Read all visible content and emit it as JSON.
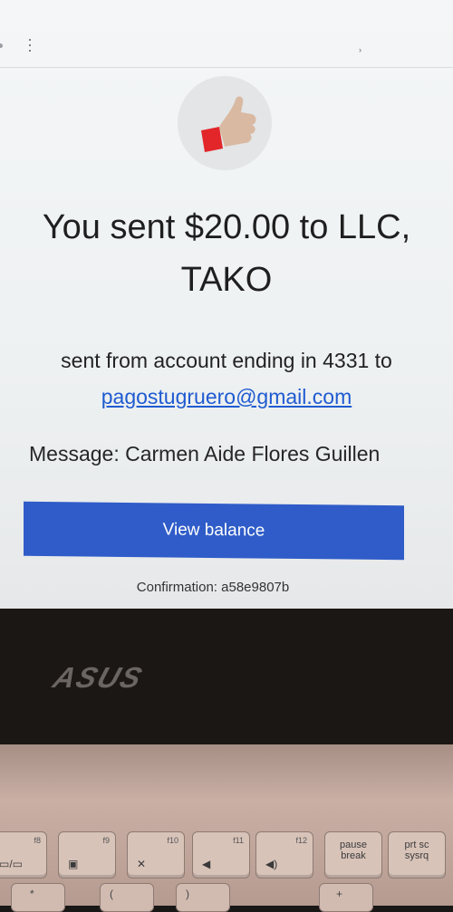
{
  "email_view": {
    "title_line1": "You sent $20.00 to LLC,",
    "title_line2": "TAKO",
    "sent_text": "sent from account ending in 4331 to",
    "email": "pagostugruero@gmail.com",
    "message": "Message: Carmen Aide Flores Guillen",
    "button_label": "View balance",
    "confirmation": "Confirmation: a58e9807b"
  },
  "brand": {
    "laptop_logo": "ASUS",
    "button_color": "#2f5cc8",
    "link_color": "#1f5bd1"
  },
  "keyboard": {
    "keys": [
      {
        "fn": "f8"
      },
      {
        "fn": "f9"
      },
      {
        "fn": "f10"
      },
      {
        "fn": "f11"
      },
      {
        "fn": "f12"
      },
      {
        "label": "pause\nbreak"
      },
      {
        "label": "prt sc\nsysrq"
      }
    ],
    "bottom_symbols": [
      "*",
      "(",
      ")",
      "+"
    ]
  },
  "icons": [
    "more-vertical-icon",
    "thumbs-up-icon"
  ]
}
